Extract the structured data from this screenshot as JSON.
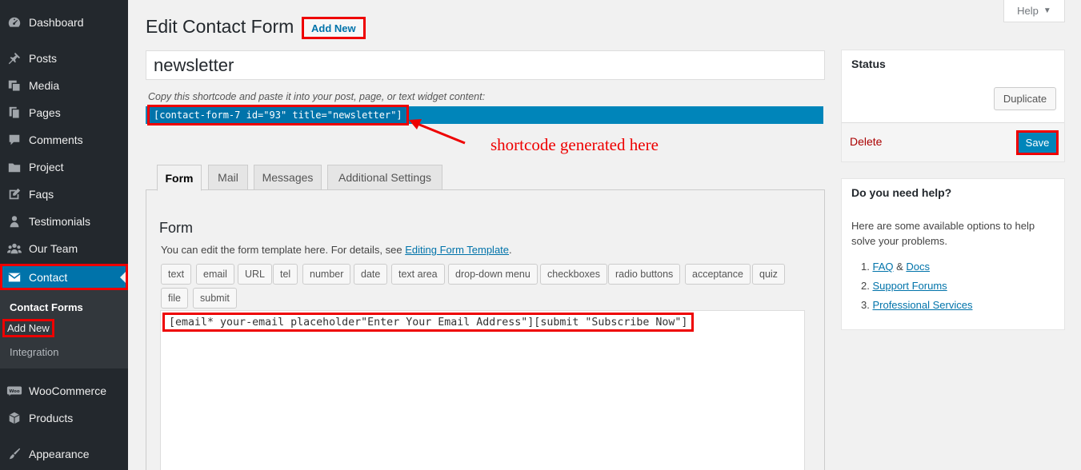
{
  "sidebar": {
    "items": [
      {
        "label": "Dashboard",
        "icon": "dashboard-icon"
      },
      {
        "label": "Posts",
        "icon": "pin-icon"
      },
      {
        "label": "Media",
        "icon": "media-icon"
      },
      {
        "label": "Pages",
        "icon": "pages-icon"
      },
      {
        "label": "Comments",
        "icon": "comment-icon"
      },
      {
        "label": "Project",
        "icon": "folder-icon"
      },
      {
        "label": "Faqs",
        "icon": "edit-icon"
      },
      {
        "label": "Testimonials",
        "icon": "user-icon"
      },
      {
        "label": "Our Team",
        "icon": "groups-icon"
      },
      {
        "label": "Contact",
        "icon": "email-icon"
      },
      {
        "label": "WooCommerce",
        "icon": "woo-icon"
      },
      {
        "label": "Products",
        "icon": "box-icon"
      },
      {
        "label": "Appearance",
        "icon": "brush-icon"
      }
    ],
    "submenu": [
      "Contact Forms",
      "Add New",
      "Integration"
    ]
  },
  "header": {
    "title": "Edit Contact Form",
    "add_new": "Add New",
    "help": "Help"
  },
  "form_title": "newsletter",
  "shortcode": {
    "description": "Copy this shortcode and paste it into your post, page, or text widget content:",
    "code": "[contact-form-7 id=\"93\" title=\"newsletter\"]",
    "annotation": "shortcode generated here"
  },
  "tabs": [
    "Form",
    "Mail",
    "Messages",
    "Additional Settings"
  ],
  "form": {
    "heading": "Form",
    "desc_prefix": "You can edit the form template here. For details, see ",
    "desc_link": "Editing Form Template",
    "desc_suffix": ".",
    "tags": [
      "text",
      "email",
      "URL",
      "tel",
      "number",
      "date",
      "text area",
      "drop-down menu",
      "checkboxes",
      "radio buttons",
      "acceptance",
      "quiz",
      "file",
      "submit"
    ],
    "code": "[email* your-email placeholder\"Enter Your Email Address\"][submit \"Subscribe Now\"]"
  },
  "status": {
    "title": "Status",
    "duplicate": "Duplicate",
    "delete": "Delete",
    "save": "Save"
  },
  "help_box": {
    "title": "Do you need help?",
    "text": "Here are some available options to help solve your problems.",
    "items": [
      {
        "num": "1.",
        "link1": "FAQ",
        "sep": " & ",
        "link2": "Docs"
      },
      {
        "num": "2.",
        "link1": "Support Forums"
      },
      {
        "num": "3.",
        "link1": "Professional Services"
      }
    ]
  },
  "colors": {
    "sidebar_bg": "#23282d",
    "accent": "#0073aa",
    "highlight": "#e00000"
  }
}
